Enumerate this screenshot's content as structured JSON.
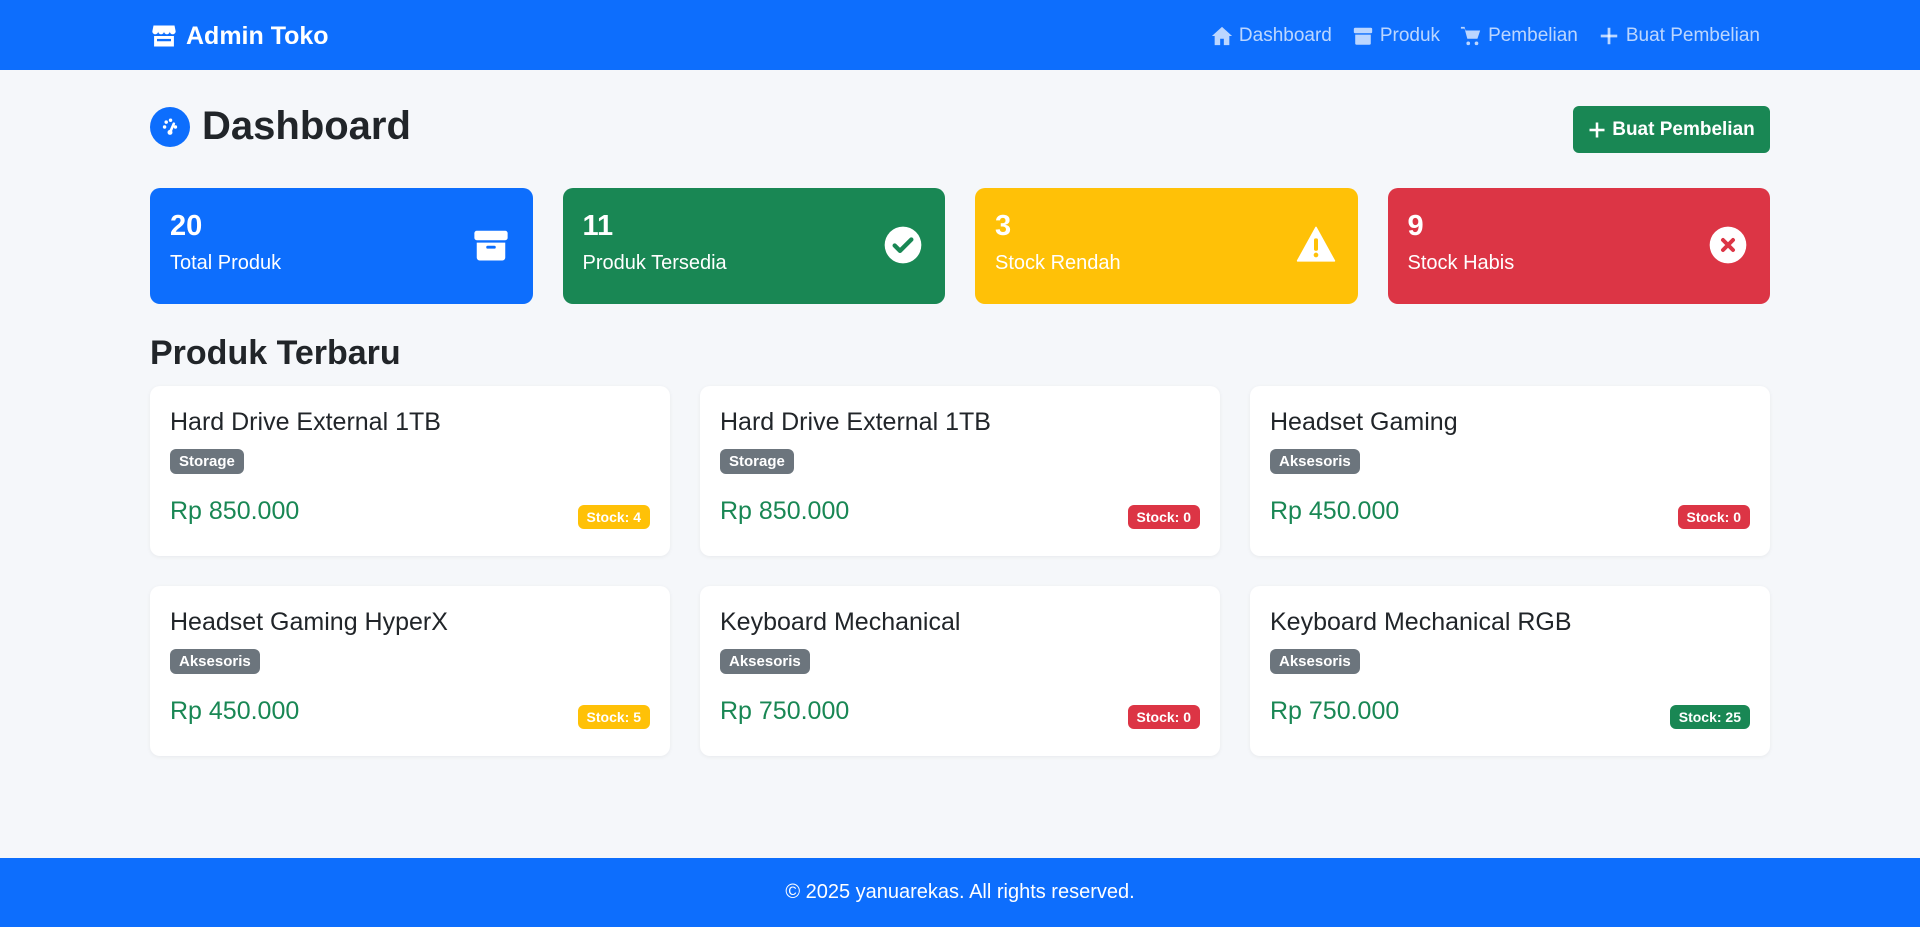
{
  "navbar": {
    "brand": "Admin Toko",
    "items": [
      {
        "label": "Dashboard",
        "icon": "home-icon"
      },
      {
        "label": "Produk",
        "icon": "box-icon"
      },
      {
        "label": "Pembelian",
        "icon": "cart-icon"
      },
      {
        "label": "Buat Pembelian",
        "icon": "plus-icon"
      }
    ]
  },
  "header": {
    "title": "Dashboard",
    "create_button": "Buat Pembelian"
  },
  "stats": [
    {
      "value": "20",
      "label": "Total Produk",
      "color": "#0d6efd",
      "icon": "box-icon"
    },
    {
      "value": "11",
      "label": "Produk Tersedia",
      "color": "#198754",
      "icon": "check-circle-icon"
    },
    {
      "value": "3",
      "label": "Stock Rendah",
      "color": "#ffc107",
      "icon": "warning-icon"
    },
    {
      "value": "9",
      "label": "Stock Habis",
      "color": "#dc3545",
      "icon": "x-circle-icon"
    }
  ],
  "section": {
    "title": "Produk Terbaru"
  },
  "products": [
    {
      "name": "Hard Drive External 1TB",
      "category": "Storage",
      "price": "Rp 850.000",
      "stock": "Stock: 4",
      "stock_status": "low"
    },
    {
      "name": "Hard Drive External 1TB",
      "category": "Storage",
      "price": "Rp 850.000",
      "stock": "Stock: 0",
      "stock_status": "empty"
    },
    {
      "name": "Headset Gaming",
      "category": "Aksesoris",
      "price": "Rp 450.000",
      "stock": "Stock: 0",
      "stock_status": "empty"
    },
    {
      "name": "Headset Gaming HyperX",
      "category": "Aksesoris",
      "price": "Rp 450.000",
      "stock": "Stock: 5",
      "stock_status": "low"
    },
    {
      "name": "Keyboard Mechanical",
      "category": "Aksesoris",
      "price": "Rp 750.000",
      "stock": "Stock: 0",
      "stock_status": "empty"
    },
    {
      "name": "Keyboard Mechanical RGB",
      "category": "Aksesoris",
      "price": "Rp 750.000",
      "stock": "Stock: 25",
      "stock_status": "ok"
    }
  ],
  "footer": {
    "text": "© 2025 yanuarekas. All rights reserved."
  }
}
